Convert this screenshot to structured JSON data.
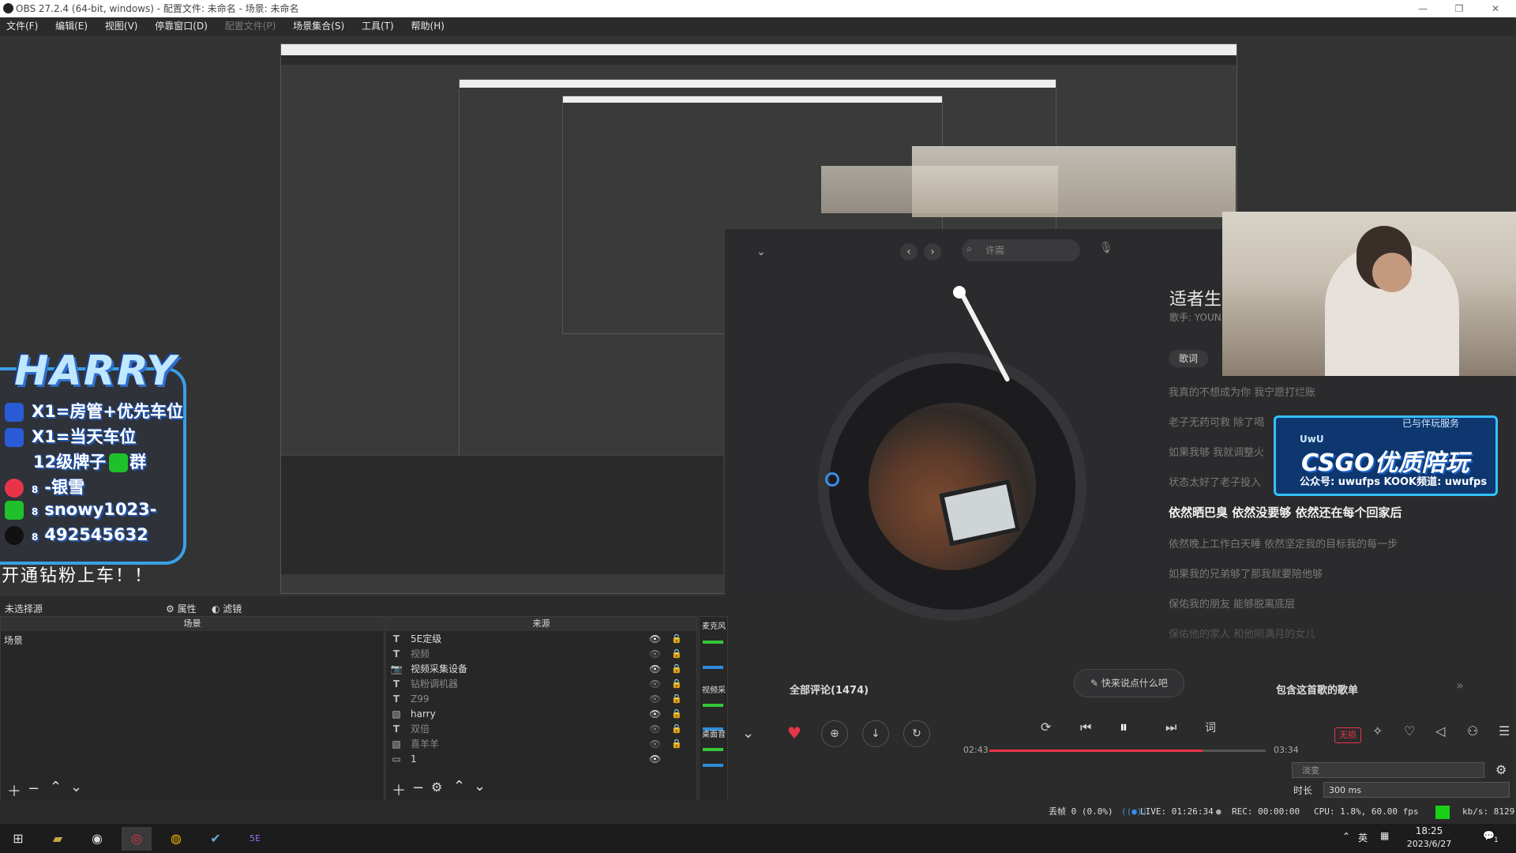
{
  "obs": {
    "window_title": "OBS 27.2.4 (64-bit, windows) - 配置文件: 未命名 - 场景: 未命名",
    "menu": [
      "文件(F)",
      "编辑(E)",
      "视图(V)",
      "停靠窗口(D)",
      "配置文件(P)",
      "场景集合(S)",
      "工具(T)",
      "帮助(H)"
    ],
    "context_bar": {
      "no_source": "未选择源",
      "properties": "属性",
      "filters": "滤镜"
    },
    "scenes_dock": {
      "title": "场景",
      "items": [
        "场景"
      ]
    },
    "sources_dock": {
      "title": "来源",
      "items": [
        {
          "icon": "T",
          "name": "5E定级",
          "visible": true
        },
        {
          "icon": "T",
          "name": "视频",
          "visible": false
        },
        {
          "icon": "📷",
          "name": "视频采集设备",
          "visible": true
        },
        {
          "icon": "T",
          "name": "钻粉调机器",
          "visible": false
        },
        {
          "icon": "T",
          "name": "Z99",
          "visible": false
        },
        {
          "icon": "▧",
          "name": "harry",
          "visible": true
        },
        {
          "icon": "T",
          "name": "双倍",
          "visible": false
        },
        {
          "icon": "▧",
          "name": "喜羊羊",
          "visible": false
        },
        {
          "icon": "▭",
          "name": "1",
          "visible": true
        }
      ]
    },
    "mixer_labels": [
      "麦克风",
      "视频采",
      "桌面音"
    ],
    "status": {
      "dropped": "丢帧 0 (0.0%)",
      "live": "LIVE: 01:26:34",
      "rec": "REC: 00:00:00",
      "cpu": "CPU: 1.8%, 60.00 fps",
      "kbs": "kb/s: 8129"
    },
    "transition": {
      "value": "淡变",
      "duration_label": "时长",
      "duration_value": "300 ms"
    }
  },
  "overlay": {
    "harry_logo": "HARRY",
    "lines": [
      {
        "icon": "x1-icon",
        "text": "X1=房管+优先车位"
      },
      {
        "icon": "x1-icon",
        "text": "X1=当天车位"
      },
      {
        "icon": "wechat-icon",
        "text": "12级牌子",
        "suffix": "群"
      },
      {
        "icon": "weibo-icon",
        "text": "-银雪"
      },
      {
        "icon": "wechat-icon",
        "text": "snowy1023-"
      },
      {
        "icon": "qq-icon",
        "text": "492545632"
      }
    ],
    "promo": "开通钻粉上车！！",
    "csgo_card": {
      "tag": "已与伴玩服务",
      "uwu": "UwU",
      "headline": "CSGO优质陪玩",
      "sub": "公众号: uwufps  KOOK频道: uwufps"
    }
  },
  "music": {
    "search_placeholder": "许嵩",
    "song_title": "适者生",
    "singer": "歌手: YOUN",
    "lyrics_tab": "歌词",
    "lyrics": [
      {
        "text": "我真的不想成为你 我宁愿打烂账",
        "active": false
      },
      {
        "text": "老子无药可救 除了喝",
        "active": false
      },
      {
        "text": "如果我够 我就调整火",
        "active": false
      },
      {
        "text": "状态太好了老子投入",
        "active": false
      },
      {
        "text": "依然晒巴臭 依然没要够 依然还在每个回家后",
        "active": true
      },
      {
        "text": "依然晚上工作白天睡 依然坚定我的目标我的每一步",
        "active": false
      },
      {
        "text": "如果我的兄弟够了那我就要陪他够",
        "active": false
      },
      {
        "text": "保佑我的朋友 能够脱离底层",
        "active": false
      },
      {
        "text": "保佑他的家人 和他刚满月的女儿",
        "active": false
      }
    ],
    "comments": "全部评论(1474)",
    "say_button": "快来说点什么吧",
    "playlist_label": "包含这首歌的歌单",
    "time_current": "02:43",
    "time_total": "03:34",
    "progress": 0.77,
    "lossless_badge": "无损",
    "lyric_btn": "词"
  },
  "taskbar": {
    "time": "18:25",
    "date": "2023/6/27",
    "ime": "英",
    "notif_count": "1"
  },
  "colors": {
    "accent_red": "#e8344a",
    "obs_bg": "#2b2b2b",
    "harry_blue": "#3aa0e6"
  }
}
